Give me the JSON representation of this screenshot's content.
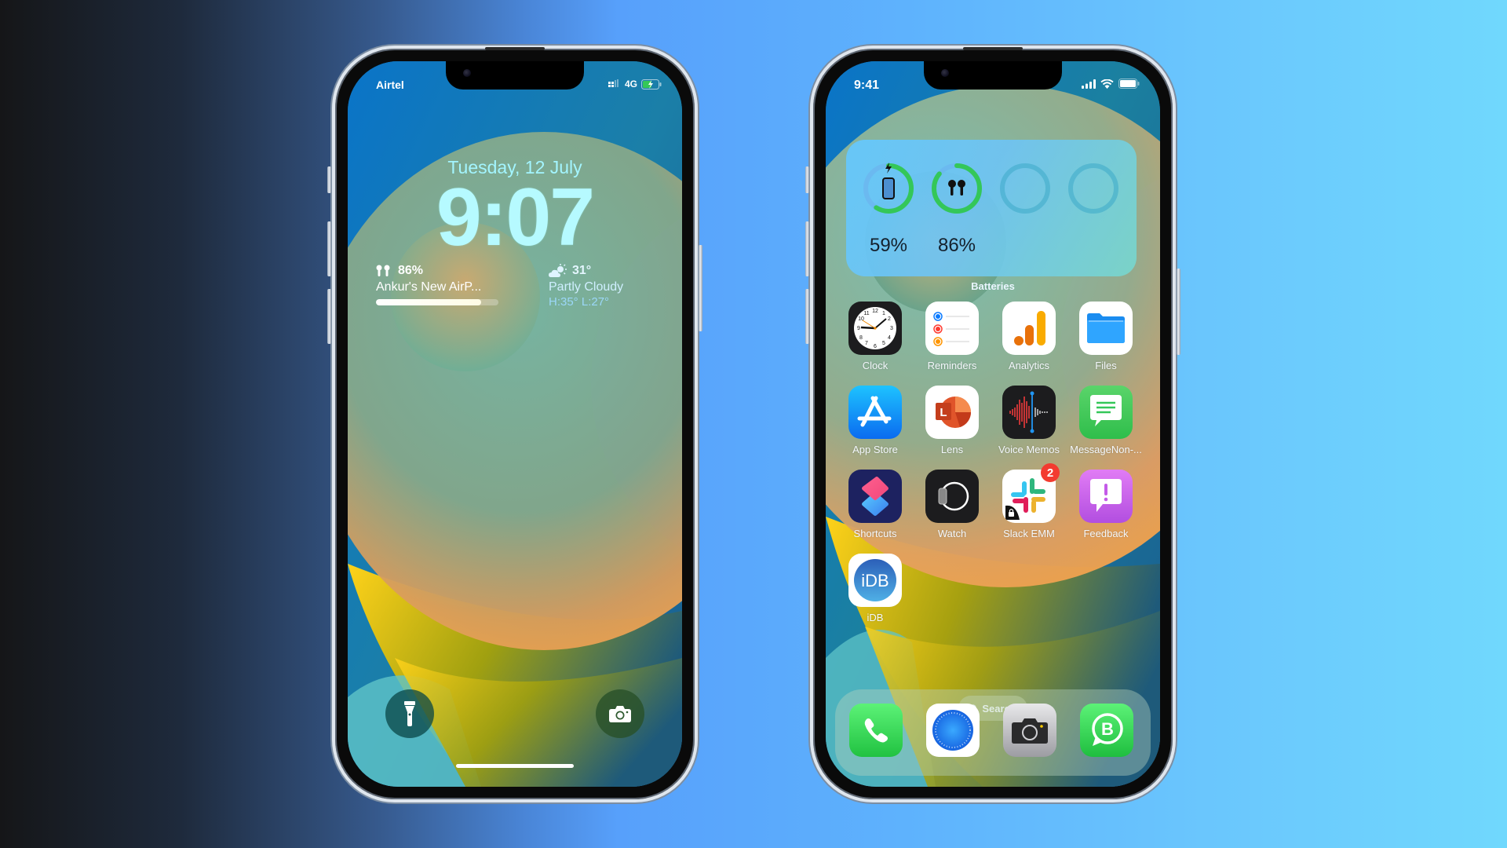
{
  "lock_screen": {
    "status": {
      "carrier": "Airtel",
      "network": "4G",
      "charging": true
    },
    "date": "Tuesday, 12 July",
    "time": "9:07",
    "airpods_widget": {
      "percent_label": "86%",
      "percent": 86,
      "device_name": "Ankur's New AirP..."
    },
    "weather_widget": {
      "temperature": "31°",
      "condition": "Partly Cloudy",
      "high_low": "H:35° L:27°"
    },
    "buttons": {
      "left": "flashlight",
      "right": "camera"
    }
  },
  "home_screen": {
    "status": {
      "time": "9:41"
    },
    "batteries_widget": {
      "label": "Batteries",
      "items": [
        {
          "device": "iPhone",
          "percent": 59,
          "label": "59%",
          "charging": true
        },
        {
          "device": "AirPods",
          "percent": 86,
          "label": "86%",
          "charging": false
        },
        {
          "device": "",
          "percent": 0,
          "label": ""
        },
        {
          "device": "",
          "percent": 0,
          "label": ""
        }
      ]
    },
    "apps": [
      {
        "name": "Clock",
        "icon": "clock-icon"
      },
      {
        "name": "Reminders",
        "icon": "reminders-icon"
      },
      {
        "name": "Analytics",
        "icon": "analytics-icon"
      },
      {
        "name": "Files",
        "icon": "files-icon"
      },
      {
        "name": "App Store",
        "icon": "app-store-icon"
      },
      {
        "name": "Lens",
        "icon": "lens-icon"
      },
      {
        "name": "Voice Memos",
        "icon": "voice-memos-icon"
      },
      {
        "name": "MessageNon-...",
        "icon": "message-icon"
      },
      {
        "name": "Shortcuts",
        "icon": "shortcuts-icon"
      },
      {
        "name": "Watch",
        "icon": "watch-icon"
      },
      {
        "name": "Slack EMM",
        "icon": "slack-icon",
        "badge": "2"
      },
      {
        "name": "Feedback",
        "icon": "feedback-icon"
      },
      {
        "name": "iDB",
        "icon": "idb-icon",
        "text": "iDB"
      }
    ],
    "search": {
      "label": "Search"
    },
    "dock": [
      {
        "name": "Phone",
        "icon": "phone-icon"
      },
      {
        "name": "Safari",
        "icon": "safari-icon"
      },
      {
        "name": "Camera",
        "icon": "camera-icon"
      },
      {
        "name": "WhatsApp Business",
        "icon": "whatsapp-business-icon"
      }
    ]
  },
  "colors": {
    "battery_green": "#34c759",
    "ring_track": "#6bb9f0",
    "badge_red": "#f33b30"
  }
}
